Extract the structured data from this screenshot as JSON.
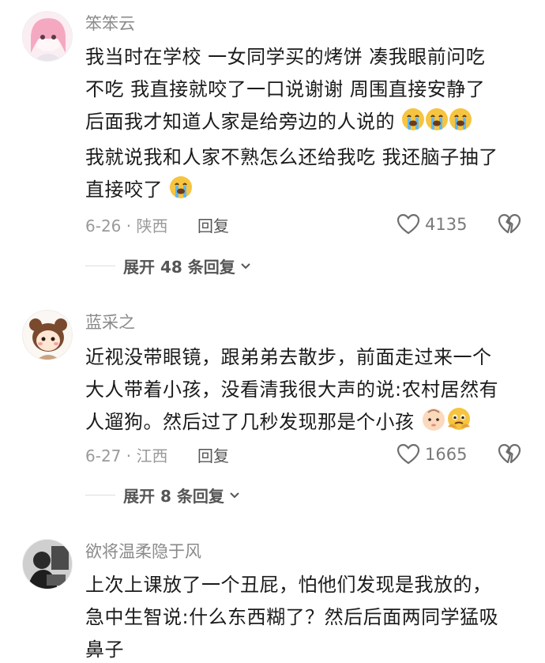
{
  "comments": [
    {
      "username": "笨笨云",
      "lines": [
        "我当时在学校 一女同学买的烤饼 凑我眼前问吃",
        "不吃 我直接就咬了一口说谢谢 周围直接安静了",
        "后面我才知道人家是给旁边的人说的",
        "我就说我和人家不熟怎么还给我吃 我还脑子抽了",
        "直接咬了"
      ],
      "meta": "6-26 · 陕西",
      "reply_label": "回复",
      "likes": "4135",
      "expand_label": "展开 48 条回复"
    },
    {
      "username": "蓝采之",
      "lines": [
        "近视没带眼镜，跟弟弟去散步，前面走过来一个",
        "大人带着小孩，没看清我很大声的说:农村居然有",
        "人遛狗。然后过了几秒发现那是个小孩"
      ],
      "meta": "6-27 · 江西",
      "reply_label": "回复",
      "likes": "1665",
      "expand_label": "展开 8 条回复"
    },
    {
      "username": "欲将温柔隐于风",
      "lines": [
        "上次上课放了一个丑屁，怕他们发现是我放的，",
        "急中生智说:什么东西糊了？然后后面两同学猛吸",
        "鼻子"
      ]
    }
  ],
  "icons": {
    "like": "heart-outline-icon",
    "dislike": "broken-heart-icon",
    "expand": "chevron-down-icon",
    "emoji_cry": "loudly-crying-face-emoji",
    "emoji_baby": "baby-face-emoji",
    "emoji_tears": "face-holding-back-tears-emoji"
  },
  "colors": {
    "accent_text": "#1b1b1b",
    "meta_gray": "#9a9a9a",
    "emoji_yellow": "#f6c440"
  }
}
